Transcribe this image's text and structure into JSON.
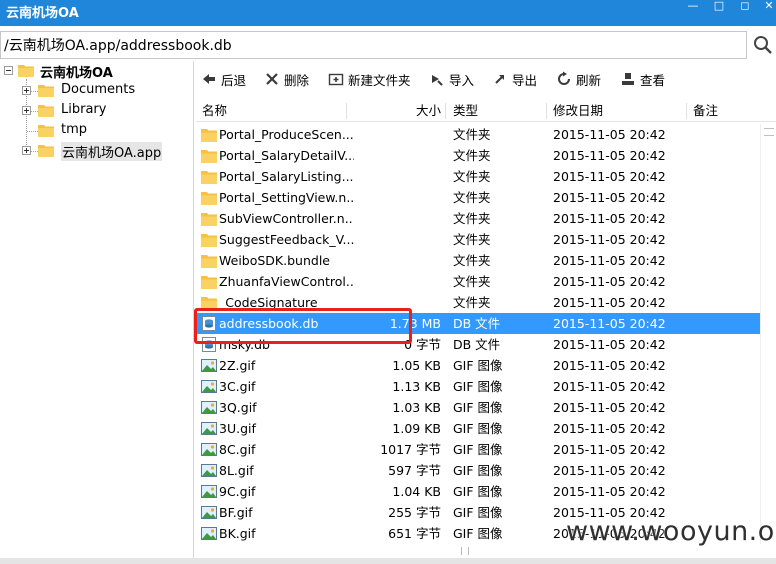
{
  "window": {
    "title": "云南机场OA"
  },
  "address": {
    "path": "/云南机场OA.app/addressbook.db"
  },
  "tree": {
    "root": "云南机场OA",
    "children": [
      {
        "label": "Documents",
        "expandable": true
      },
      {
        "label": "Library",
        "expandable": true
      },
      {
        "label": "tmp",
        "expandable": false
      },
      {
        "label": "云南机场OA.app",
        "expandable": true
      }
    ]
  },
  "toolbar": {
    "back": "后退",
    "delete": "删除",
    "new_folder": "新建文件夹",
    "import": "导入",
    "export": "导出",
    "refresh": "刷新",
    "view": "查看"
  },
  "columns": {
    "name": "名称",
    "size": "大小",
    "type": "类型",
    "modified": "修改日期",
    "note": "备注"
  },
  "files": [
    {
      "name": "Portal_ProduceScen...",
      "size": "",
      "type": "文件夹",
      "date": "2015-11-05 20:42",
      "icon": "folder-icon"
    },
    {
      "name": "Portal_SalaryDetailV...",
      "size": "",
      "type": "文件夹",
      "date": "2015-11-05 20:42",
      "icon": "folder-icon"
    },
    {
      "name": "Portal_SalaryListing...",
      "size": "",
      "type": "文件夹",
      "date": "2015-11-05 20:42",
      "icon": "folder-icon"
    },
    {
      "name": "Portal_SettingView.n...",
      "size": "",
      "type": "文件夹",
      "date": "2015-11-05 20:42",
      "icon": "folder-icon"
    },
    {
      "name": "SubViewController.n...",
      "size": "",
      "type": "文件夹",
      "date": "2015-11-05 20:42",
      "icon": "folder-icon"
    },
    {
      "name": "SuggestFeedback_V...",
      "size": "",
      "type": "文件夹",
      "date": "2015-11-05 20:42",
      "icon": "folder-icon"
    },
    {
      "name": "WeiboSDK.bundle",
      "size": "",
      "type": "文件夹",
      "date": "2015-11-05 20:42",
      "icon": "folder-icon"
    },
    {
      "name": "ZhuanfaViewControl...",
      "size": "",
      "type": "文件夹",
      "date": "2015-11-05 20:42",
      "icon": "folder-icon"
    },
    {
      "name": "_CodeSignature",
      "size": "",
      "type": "文件夹",
      "date": "2015-11-05 20:42",
      "icon": "folder-icon"
    },
    {
      "name": "addressbook.db",
      "size": "1.73 MB",
      "type": "DB 文件",
      "date": "2015-11-05 20:42",
      "icon": "db-file-icon",
      "selected": true
    },
    {
      "name": "msky.db",
      "size": "0 字节",
      "type": "DB 文件",
      "date": "2015-11-05 20:42",
      "icon": "db-file-icon"
    },
    {
      "name": "2Z.gif",
      "size": "1.05 KB",
      "type": "GIF 图像",
      "date": "2015-11-05 20:42",
      "icon": "image-icon"
    },
    {
      "name": "3C.gif",
      "size": "1.13 KB",
      "type": "GIF 图像",
      "date": "2015-11-05 20:42",
      "icon": "image-icon"
    },
    {
      "name": "3Q.gif",
      "size": "1.03 KB",
      "type": "GIF 图像",
      "date": "2015-11-05 20:42",
      "icon": "image-icon"
    },
    {
      "name": "3U.gif",
      "size": "1.09 KB",
      "type": "GIF 图像",
      "date": "2015-11-05 20:42",
      "icon": "image-icon"
    },
    {
      "name": "8C.gif",
      "size": "1017 字节",
      "type": "GIF 图像",
      "date": "2015-11-05 20:42",
      "icon": "image-icon"
    },
    {
      "name": "8L.gif",
      "size": "597 字节",
      "type": "GIF 图像",
      "date": "2015-11-05 20:42",
      "icon": "image-icon"
    },
    {
      "name": "9C.gif",
      "size": "1.04 KB",
      "type": "GIF 图像",
      "date": "2015-11-05 20:42",
      "icon": "image-icon"
    },
    {
      "name": "BF.gif",
      "size": "255 字节",
      "type": "GIF 图像",
      "date": "2015-11-05 20:42",
      "icon": "image-icon"
    },
    {
      "name": "BK.gif",
      "size": "651 字节",
      "type": "GIF 图像",
      "date": "2015-11-05 20:42",
      "icon": "image-icon"
    }
  ],
  "watermark": "www.wooyun.org",
  "colors": {
    "titlebar": "#1f86d9",
    "selection": "#3399ff",
    "highlight": "#e8211b",
    "folder": "#f5c242"
  }
}
